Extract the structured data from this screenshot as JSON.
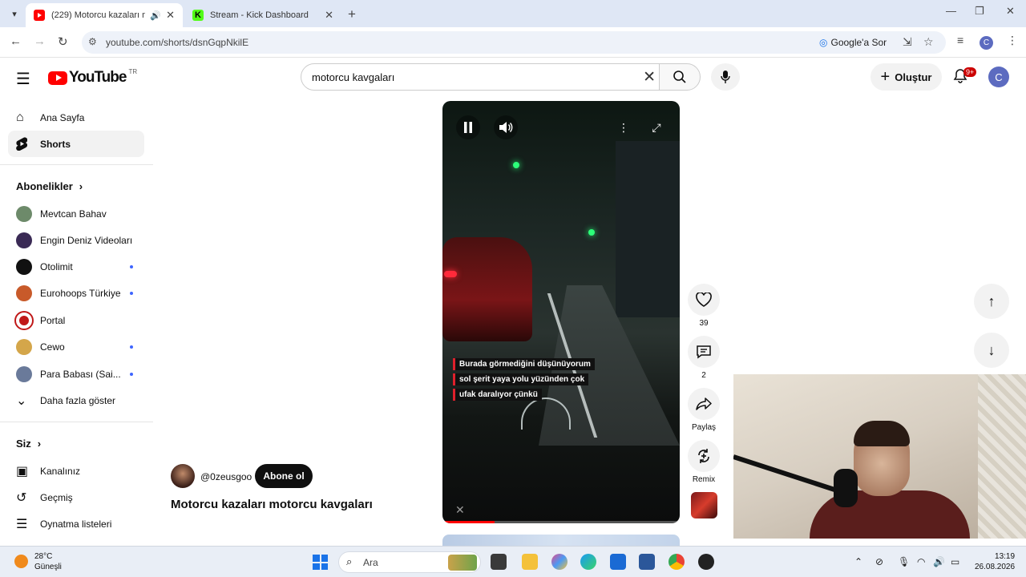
{
  "browser": {
    "tabs": [
      {
        "title": "(229) Motorcu kazaları mot",
        "active": true
      },
      {
        "title": "Stream - Kick Dashboard",
        "active": false
      }
    ],
    "url": "youtube.com/shorts/dsnGqpNkilE",
    "lens_label": "Google'a Sor",
    "profile_initial": "C"
  },
  "header": {
    "logo_text": "YouTube",
    "country_code": "TR",
    "search_query": "motorcu kavgaları",
    "create_label": "Oluştur",
    "notification_count": "9+",
    "avatar_initial": "C"
  },
  "sidebar": {
    "main": [
      {
        "label": "Ana Sayfa",
        "icon": "home-icon"
      },
      {
        "label": "Shorts",
        "icon": "shorts-icon"
      }
    ],
    "subscriptions_title": "Abonelikler",
    "subscriptions": [
      {
        "label": "Mevtcan Bahav",
        "new": false,
        "color": "#6d8a6a"
      },
      {
        "label": "Engin Deniz Videoları",
        "new": false,
        "color": "#3a2a55"
      },
      {
        "label": "Otolimit",
        "new": true,
        "color": "#111111"
      },
      {
        "label": "Eurohoops Türkiye",
        "new": true,
        "color": "#c85a2a"
      },
      {
        "label": "Portal",
        "new": false,
        "color": "#c01818"
      },
      {
        "label": "Cewo",
        "new": true,
        "color": "#d4a64a"
      },
      {
        "label": "Para Babası (Sai...",
        "new": true,
        "color": "#6a7a9a"
      }
    ],
    "show_more": "Daha fazla göster",
    "you_title": "Siz",
    "you_items": [
      {
        "label": "Kanalınız",
        "icon": "channel-icon"
      },
      {
        "label": "Geçmiş",
        "icon": "history-icon"
      },
      {
        "label": "Oynatma listeleri",
        "icon": "playlist-icon"
      }
    ]
  },
  "short": {
    "caption_lines": [
      "Burada görmediğini düşünüyorum",
      "sol şerit yaya yolu yüzünden çok",
      "ufak daralıyor çünkü"
    ],
    "progress": 0.22,
    "channel_handle": "@0zeusgoo",
    "subscribe_label": "Abone ol",
    "title": "Motorcu kazaları motorcu kavgaları",
    "actions": {
      "like_count": "39",
      "comment_count": "2",
      "share_label": "Paylaş",
      "remix_label": "Remix"
    }
  },
  "taskbar": {
    "temperature": "28°C",
    "weather": "Güneşli",
    "search_label": "Ara",
    "time": "13:19",
    "date": "26.08.2026"
  },
  "colors": {
    "youtube_red": "#ff0000",
    "accent_blue": "#1a73e8",
    "new_dot": "#3e65ff"
  }
}
